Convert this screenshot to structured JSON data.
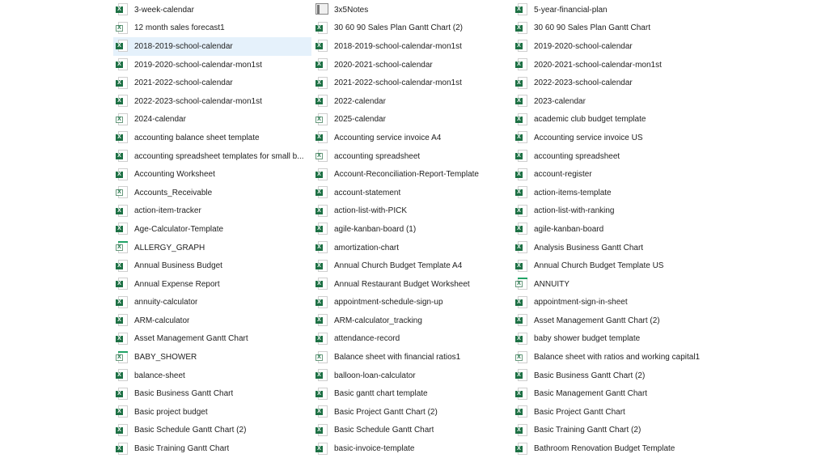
{
  "accent": "#1e7145",
  "selection_color": "#e5f1fb",
  "selected": "2018-2019-school-calendar",
  "columns": [
    [
      {
        "name": "3-week-calendar",
        "icon": "x"
      },
      {
        "name": "12 month sales forecast1",
        "icon": "t"
      },
      {
        "name": "2018-2019-school-calendar",
        "icon": "x"
      },
      {
        "name": "2019-2020-school-calendar-mon1st",
        "icon": "x"
      },
      {
        "name": "2021-2022-school-calendar",
        "icon": "x"
      },
      {
        "name": "2022-2023-school-calendar-mon1st",
        "icon": "x"
      },
      {
        "name": "2024-calendar",
        "icon": "t"
      },
      {
        "name": "accounting balance sheet template",
        "icon": "x"
      },
      {
        "name": "accounting spreadsheet templates for small b...",
        "icon": "x"
      },
      {
        "name": "Accounting Worksheet",
        "icon": "x"
      },
      {
        "name": "Accounts_Receivable",
        "icon": "t"
      },
      {
        "name": "action-item-tracker",
        "icon": "x"
      },
      {
        "name": "Age-Calculator-Template",
        "icon": "x"
      },
      {
        "name": "ALLERGY_GRAPH",
        "icon": "g"
      },
      {
        "name": "Annual Business Budget",
        "icon": "x"
      },
      {
        "name": "Annual Expense Report",
        "icon": "x"
      },
      {
        "name": "annuity-calculator",
        "icon": "x"
      },
      {
        "name": "ARM-calculator",
        "icon": "x"
      },
      {
        "name": "Asset Management Gantt Chart",
        "icon": "x"
      },
      {
        "name": "BABY_SHOWER",
        "icon": "g"
      },
      {
        "name": "balance-sheet",
        "icon": "x"
      },
      {
        "name": "Basic Business Gantt Chart",
        "icon": "x"
      },
      {
        "name": "Basic project budget",
        "icon": "x"
      },
      {
        "name": "Basic Schedule Gantt Chart (2)",
        "icon": "x"
      },
      {
        "name": "Basic Training Gantt Chart",
        "icon": "x"
      }
    ],
    [
      {
        "name": "3x5Notes",
        "icon": "n"
      },
      {
        "name": "30 60 90 Sales Plan Gantt Chart (2)",
        "icon": "x"
      },
      {
        "name": "2018-2019-school-calendar-mon1st",
        "icon": "x"
      },
      {
        "name": "2020-2021-school-calendar",
        "icon": "x"
      },
      {
        "name": "2021-2022-school-calendar-mon1st",
        "icon": "x"
      },
      {
        "name": "2022-calendar",
        "icon": "x"
      },
      {
        "name": "2025-calendar",
        "icon": "t"
      },
      {
        "name": "Accounting service  invoice A4",
        "icon": "x"
      },
      {
        "name": "accounting spreadsheet",
        "icon": "t"
      },
      {
        "name": "Account-Reconciliation-Report-Template",
        "icon": "x"
      },
      {
        "name": "account-statement",
        "icon": "x"
      },
      {
        "name": "action-list-with-PICK",
        "icon": "x"
      },
      {
        "name": "agile-kanban-board (1)",
        "icon": "x"
      },
      {
        "name": "amortization-chart",
        "icon": "x"
      },
      {
        "name": "Annual Church Budget Template A4",
        "icon": "x"
      },
      {
        "name": "Annual Restaurant Budget Worksheet",
        "icon": "x"
      },
      {
        "name": "appointment-schedule-sign-up",
        "icon": "x"
      },
      {
        "name": "ARM-calculator_tracking",
        "icon": "x"
      },
      {
        "name": "attendance-record",
        "icon": "x"
      },
      {
        "name": "Balance sheet with financial ratios1",
        "icon": "t"
      },
      {
        "name": "balloon-loan-calculator",
        "icon": "x"
      },
      {
        "name": "Basic gantt chart template",
        "icon": "x"
      },
      {
        "name": "Basic Project Gantt Chart (2)",
        "icon": "x"
      },
      {
        "name": "Basic Schedule Gantt Chart",
        "icon": "x"
      },
      {
        "name": "basic-invoice-template",
        "icon": "x"
      }
    ],
    [
      {
        "name": "5-year-financial-plan",
        "icon": "x"
      },
      {
        "name": "30 60 90 Sales Plan Gantt Chart",
        "icon": "x"
      },
      {
        "name": "2019-2020-school-calendar",
        "icon": "x"
      },
      {
        "name": "2020-2021-school-calendar-mon1st",
        "icon": "x"
      },
      {
        "name": "2022-2023-school-calendar",
        "icon": "x"
      },
      {
        "name": "2023-calendar",
        "icon": "x"
      },
      {
        "name": "academic club budget template",
        "icon": "x"
      },
      {
        "name": "Accounting service  invoice US",
        "icon": "x"
      },
      {
        "name": "accounting spreadsheet",
        "icon": "x"
      },
      {
        "name": "account-register",
        "icon": "x"
      },
      {
        "name": "action-items-template",
        "icon": "x"
      },
      {
        "name": "action-list-with-ranking",
        "icon": "x"
      },
      {
        "name": "agile-kanban-board",
        "icon": "x"
      },
      {
        "name": "Analysis Business Gantt Chart",
        "icon": "x"
      },
      {
        "name": "Annual Church Budget Template US",
        "icon": "x"
      },
      {
        "name": "ANNUITY",
        "icon": "g"
      },
      {
        "name": "appointment-sign-in-sheet",
        "icon": "x"
      },
      {
        "name": "Asset Management Gantt Chart (2)",
        "icon": "x"
      },
      {
        "name": "baby shower budget template",
        "icon": "x"
      },
      {
        "name": "Balance sheet with ratios and working capital1",
        "icon": "t"
      },
      {
        "name": "Basic Business Gantt Chart (2)",
        "icon": "x"
      },
      {
        "name": "Basic Management Gantt Chart",
        "icon": "x"
      },
      {
        "name": "Basic Project Gantt Chart",
        "icon": "x"
      },
      {
        "name": "Basic Training Gantt Chart (2)",
        "icon": "x"
      },
      {
        "name": "Bathroom Renovation Budget Template",
        "icon": "x"
      }
    ]
  ]
}
